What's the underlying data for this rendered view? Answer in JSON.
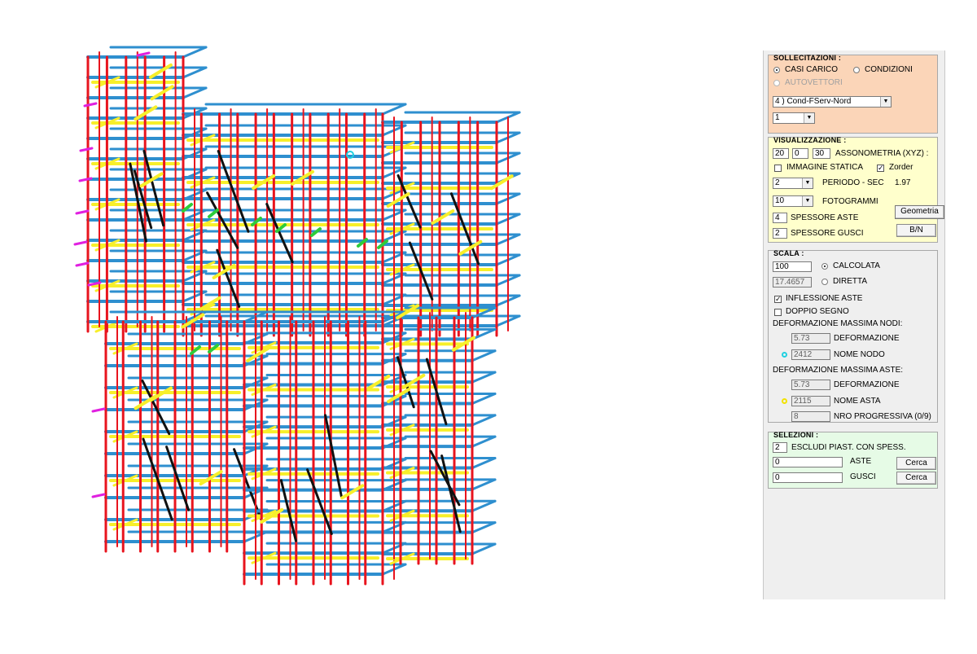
{
  "colors": {
    "beam_blue": "#2e8fcf",
    "column_red": "#e8141e",
    "slab_yellow": "#f7ef2a",
    "brace_black": "#111111",
    "node_magenta": "#e020e0",
    "support_green": "#2ecc3a",
    "sollecitazioni_bg": "#fbd5b8",
    "visualizzazione_bg": "#ffffcc",
    "selezioni_bg": "#e6fbe6",
    "node_marker": "#20d0e0",
    "beam_marker": "#f2e200"
  },
  "sollecitazioni": {
    "title": "SOLLECITAZIONI :",
    "casi_carico": "CASI CARICO",
    "condizioni": "CONDIZIONI",
    "autovettori": "AUTOVETTORI",
    "selected_mode": "CASI CARICO",
    "case_select": "4 ) Cond-FServ-Nord",
    "sub_select": "1"
  },
  "visualizzazione": {
    "title": "VISUALIZZAZIONE :",
    "ax": "20",
    "ay": "0",
    "az": "30",
    "assonometria": "ASSONOMETRIA (XYZ) :",
    "immagine_statica": "IMMAGINE STATICA",
    "immagine_statica_checked": false,
    "zorder": "Zorder",
    "zorder_checked": true,
    "periodo_value": "2",
    "periodo_label": "PERIODO - SEC",
    "periodo_sec": "1.97",
    "fotogrammi_value": "10",
    "fotogrammi_label": "FOTOGRAMMI",
    "spessore_aste_value": "4",
    "spessore_aste_label": "SPESSORE ASTE",
    "spessore_gusci_value": "2",
    "spessore_gusci_label": "SPESSORE GUSCI",
    "geometria_button": "Geometria",
    "bn_button": "B/N"
  },
  "scala": {
    "title": "SCALA :",
    "calcolata_value": "100",
    "calcolata_label": "CALCOLATA",
    "diretta_value": "17.4657",
    "diretta_label": "DIRETTA",
    "selected": "CALCOLATA",
    "inflessione_aste": "INFLESSIONE ASTE",
    "inflessione_checked": true,
    "doppio_segno": "DOPPIO SEGNO",
    "doppio_checked": false,
    "def_max_nodi": "DEFORMAZIONE MASSIMA NODI:",
    "nodi_def_value": "5.73",
    "nodi_def_label": "DEFORMAZIONE",
    "nodo_value": "2412",
    "nodo_label": "NOME NODO",
    "def_max_aste": "DEFORMAZIONE MASSIMA ASTE:",
    "aste_def_value": "5.73",
    "aste_def_label": "DEFORMAZIONE",
    "asta_value": "2115",
    "asta_label": "NOME ASTA",
    "nro_value": "8",
    "nro_label": "NRO PROGRESSIVA (0/9)"
  },
  "selezioni": {
    "title": "SELEZIONI :",
    "escludi_value": "2",
    "escludi_label": "ESCLUDI PIAST. CON SPESS.",
    "aste_value": "0",
    "aste_label": "ASTE",
    "gusci_value": "0",
    "gusci_label": "GUSCI",
    "cerca_label": "Cerca"
  }
}
